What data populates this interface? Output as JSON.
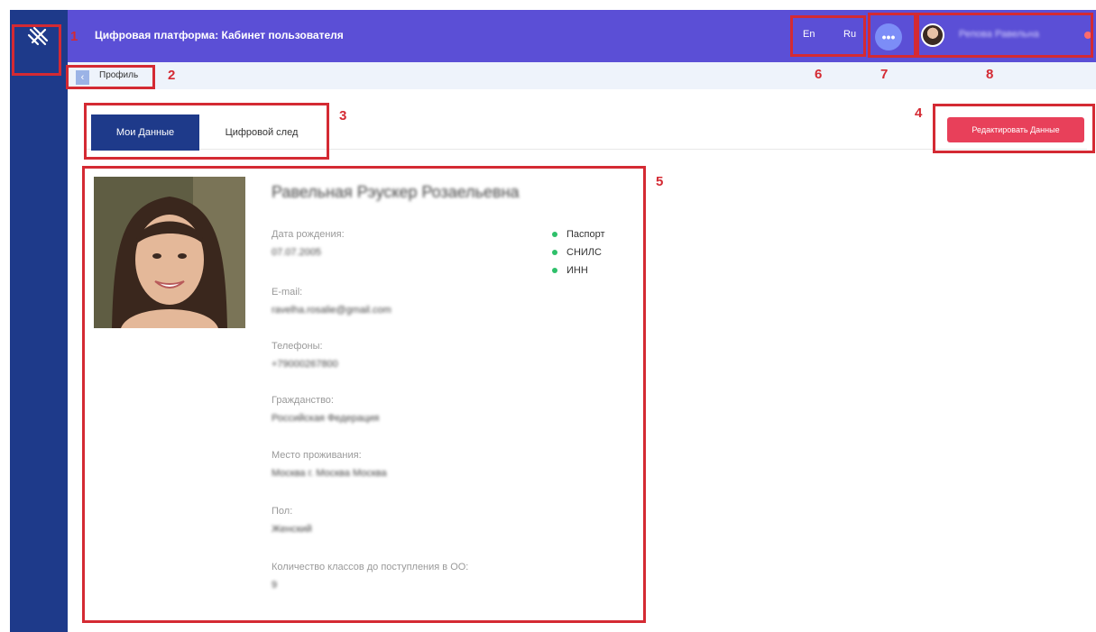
{
  "header": {
    "title": "Цифровая платформа: Кабинет пользователя",
    "lang_en": "En",
    "lang_ru": "Ru",
    "more_label": "•••",
    "user_name": "Репова Равельна"
  },
  "breadcrumb": {
    "back_label": "‹",
    "label": "Профиль"
  },
  "tabs": [
    {
      "label": "Мои Данные",
      "active": true
    },
    {
      "label": "Цифровой след",
      "active": false
    }
  ],
  "edit_button": "Редактировать Данные",
  "profile": {
    "full_name": "Равельная Рэускер Розаельевна",
    "fields": [
      {
        "label": "Дата рождения:",
        "value": "07.07.2005"
      },
      {
        "label": "E-mail:",
        "value": "ravelha.rosalie@gmail.com"
      },
      {
        "label": "Телефоны:",
        "value": "+79000267800"
      },
      {
        "label": "Гражданство:",
        "value": "Российская Федерация"
      },
      {
        "label": "Место проживания:",
        "value": "Москва г. Москва Москва"
      },
      {
        "label": "Пол:",
        "value": "Женский"
      },
      {
        "label": "Количество классов до поступления в ОО:",
        "value": "9"
      }
    ],
    "documents": [
      "Паспорт",
      "СНИЛС",
      "ИНН"
    ]
  },
  "annotations": [
    "1",
    "2",
    "3",
    "4",
    "5",
    "6",
    "7",
    "8"
  ],
  "colors": {
    "sidebar": "#1e3a8a",
    "header": "#5b4fd6",
    "accent_red": "#e8405a",
    "status_green": "#2ec06a",
    "annotation_red": "#d42a33"
  }
}
